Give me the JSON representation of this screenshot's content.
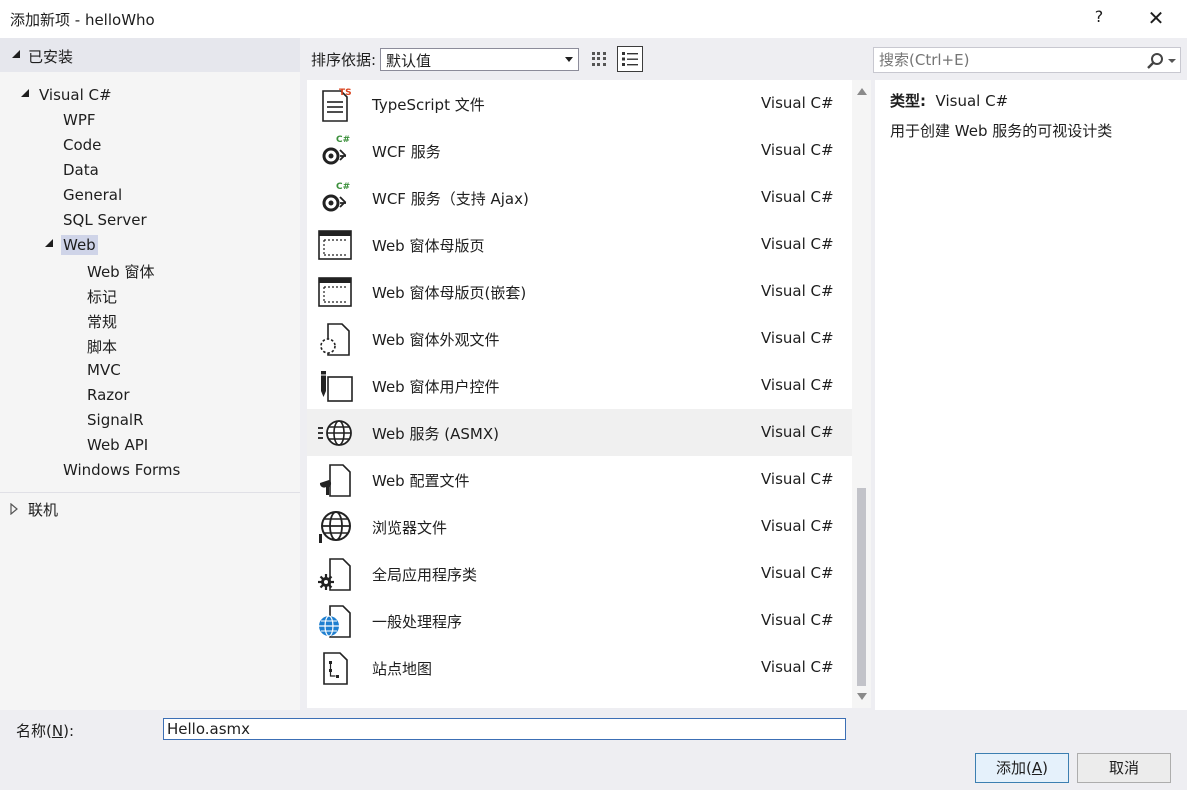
{
  "window": {
    "title": "添加新项 - helloWho",
    "help": "?",
    "close": "✕"
  },
  "tree": {
    "installed_label": "已安装",
    "online_label": "联机",
    "root": "Visual C#",
    "children": [
      "WPF",
      "Code",
      "Data",
      "General",
      "SQL Server",
      "Web",
      "Windows Forms"
    ],
    "web_children": [
      "Web 窗体",
      "标记",
      "常规",
      "脚本",
      "MVC",
      "Razor",
      "SignalR",
      "Web API"
    ]
  },
  "toolbar": {
    "sort_label": "排序依据:",
    "sort_value": "默认值"
  },
  "search": {
    "placeholder": "搜索(Ctrl+E)"
  },
  "items": [
    {
      "name": "TypeScript 文件",
      "lang": "Visual C#",
      "icon": "typescript-file-icon"
    },
    {
      "name": "WCF 服务",
      "lang": "Visual C#",
      "icon": "wcf-service-icon"
    },
    {
      "name": "WCF 服务（支持 Ajax)",
      "lang": "Visual C#",
      "icon": "wcf-ajax-service-icon"
    },
    {
      "name": "Web 窗体母版页",
      "lang": "Visual C#",
      "icon": "master-page-icon"
    },
    {
      "name": "Web 窗体母版页(嵌套)",
      "lang": "Visual C#",
      "icon": "nested-master-page-icon"
    },
    {
      "name": "Web 窗体外观文件",
      "lang": "Visual C#",
      "icon": "skin-file-icon"
    },
    {
      "name": "Web 窗体用户控件",
      "lang": "Visual C#",
      "icon": "user-control-icon"
    },
    {
      "name": "Web 服务 (ASMX)",
      "lang": "Visual C#",
      "icon": "web-service-icon"
    },
    {
      "name": "Web 配置文件",
      "lang": "Visual C#",
      "icon": "web-config-icon"
    },
    {
      "name": "浏览器文件",
      "lang": "Visual C#",
      "icon": "browser-file-icon"
    },
    {
      "name": "全局应用程序类",
      "lang": "Visual C#",
      "icon": "global-app-class-icon"
    },
    {
      "name": "一般处理程序",
      "lang": "Visual C#",
      "icon": "generic-handler-icon"
    },
    {
      "name": "站点地图",
      "lang": "Visual C#",
      "icon": "site-map-icon"
    }
  ],
  "description": {
    "type_label": "类型:",
    "type_value": "Visual C#",
    "text": "用于创建 Web 服务的可视设计类"
  },
  "name_field": {
    "label_pre": "名称(",
    "label_key": "N",
    "label_post": "):",
    "value": "Hello.asmx"
  },
  "buttons": {
    "add_pre": "添加(",
    "add_key": "A",
    "add_post": ")",
    "cancel": "取消"
  }
}
